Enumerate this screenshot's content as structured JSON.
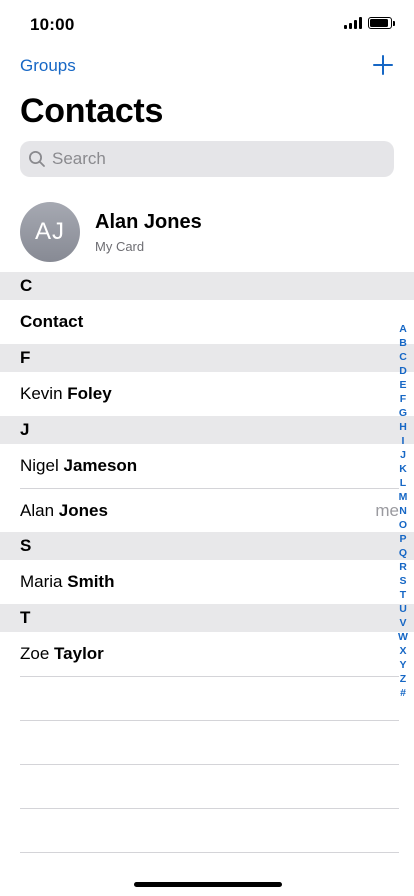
{
  "status_bar": {
    "time": "10:00",
    "battery_level": 0.9
  },
  "nav": {
    "groups_label": "Groups",
    "add_icon": "plus-icon"
  },
  "title": "Contacts",
  "search": {
    "placeholder": "Search",
    "icon": "search-icon"
  },
  "my_card": {
    "initials": "AJ",
    "name": "Alan Jones",
    "label": "My Card"
  },
  "sections": [
    {
      "letter": "C",
      "contacts": [
        {
          "first": "",
          "last": "Contact",
          "tag": ""
        }
      ]
    },
    {
      "letter": "F",
      "contacts": [
        {
          "first": "Kevin",
          "last": "Foley",
          "tag": ""
        }
      ]
    },
    {
      "letter": "J",
      "contacts": [
        {
          "first": "Nigel",
          "last": "Jameson",
          "tag": ""
        },
        {
          "first": "Alan",
          "last": "Jones",
          "tag": "me"
        }
      ]
    },
    {
      "letter": "S",
      "contacts": [
        {
          "first": "Maria",
          "last": "Smith",
          "tag": ""
        }
      ]
    },
    {
      "letter": "T",
      "contacts": [
        {
          "first": "Zoe",
          "last": "Taylor",
          "tag": ""
        }
      ]
    }
  ],
  "index_letters": [
    "A",
    "B",
    "C",
    "D",
    "E",
    "F",
    "G",
    "H",
    "I",
    "J",
    "K",
    "L",
    "M",
    "N",
    "O",
    "P",
    "Q",
    "R",
    "S",
    "T",
    "U",
    "V",
    "W",
    "X",
    "Y",
    "Z",
    "#"
  ],
  "colors": {
    "accent": "#1667c5",
    "section_bg": "#e8e8ea",
    "search_bg": "#e5e5e8"
  }
}
